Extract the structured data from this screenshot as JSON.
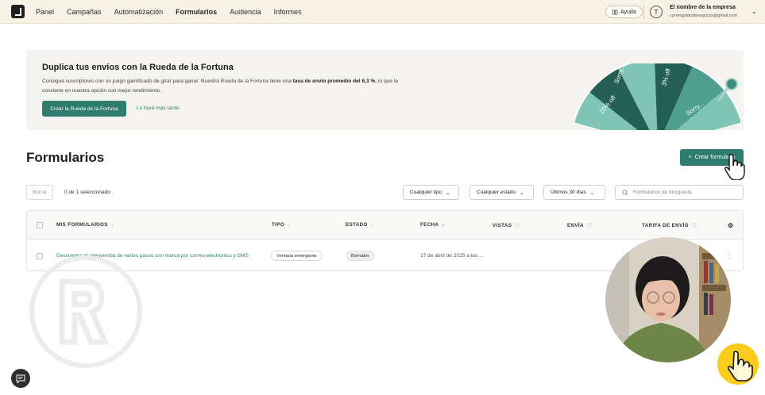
{
  "topbar": {
    "nav": [
      "Panel",
      "Campañas",
      "Automatización",
      "Formularios",
      "Audiencia",
      "Informes"
    ],
    "active_nav": "Formularios",
    "help_label": "Ayuda",
    "avatar_initial": "T",
    "company_name": "El nombre de la empresa",
    "company_email": "correogratisdenegocio@gmail.com"
  },
  "banner": {
    "title": "Duplica tus envíos con la Rueda de la Fortuna",
    "text_before": "Consigue suscriptores con un juego gamificado de girar para ganar. Nuestra Rueda de la Fortuna tiene una ",
    "text_bold": "tasa de envío promedio del 6,3 %",
    "text_after": ", lo que la convierte en nuestra opción con mejor rendimiento.",
    "primary_button": "Crear la Rueda de la Fortuna",
    "secondary_link": "Lo haré más tarde",
    "wheel_labels": [
      "Sorry...",
      "20% off",
      "3% off",
      "Sorry..."
    ]
  },
  "page": {
    "title": "Formularios",
    "create_button": "Crear formulario"
  },
  "toolbar": {
    "delete_label": "Borrar",
    "selection_count": "0 de 1 seleccionado",
    "filter_type": "Cualquier tipo",
    "filter_status": "Cualquier estado",
    "filter_date": "Últimos 30 días",
    "search_placeholder": "Formularios de búsqueda"
  },
  "table": {
    "headers": [
      "MIS FORMULARIOS",
      "TIPO",
      "ESTADO",
      "FECHA",
      "VISTAS",
      "ENVÍA",
      "TARIFA DE ENVÍO"
    ],
    "rows": [
      {
        "name": "Descuento de bienvenida de varios pasos con marca por correo electrónico y SMS",
        "type": "Ventana emergente",
        "status": "Borrador",
        "date": "17 de abril de 2025 a las ..."
      }
    ]
  },
  "colors": {
    "accent": "#2e7d6e",
    "topbar_bg": "#f7f1e6",
    "banner_bg": "#f4f3ef"
  }
}
